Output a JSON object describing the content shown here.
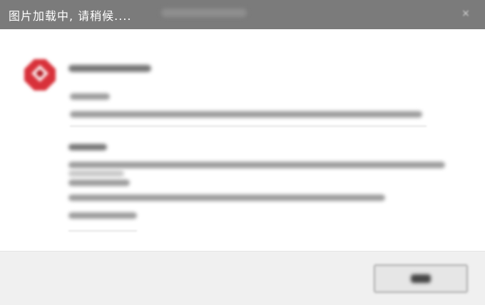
{
  "window": {
    "title": "图片加载中, 请稍候....",
    "close_glyph": "×"
  },
  "icon": {
    "name": "error-icon",
    "color": "#d8313a"
  },
  "colors": {
    "titlebar": "#7b7b7b",
    "content_bg": "#ffffff",
    "footer_bg": "#f0f0f0",
    "button_border": "#a9a9a9"
  }
}
